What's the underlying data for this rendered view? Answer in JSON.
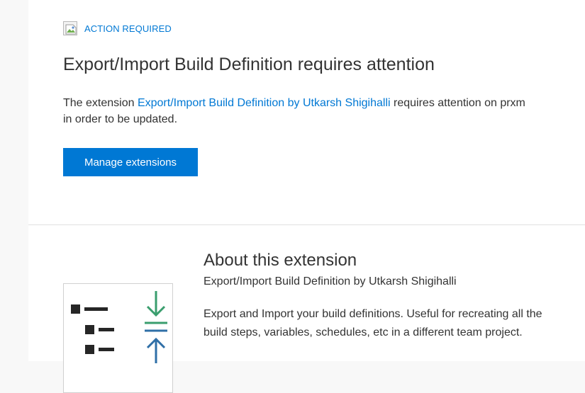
{
  "notice": {
    "badge_label": "ACTION REQUIRED",
    "badge_icon": "broken-image-icon",
    "title": "Export/Import Build Definition requires attention",
    "body_prefix": "The extension ",
    "extension_link": "Export/Import Build Definition by Utkarsh Shigihalli",
    "body_suffix": " requires attention on prxm in order to be updated.",
    "manage_button_label": "Manage extensions"
  },
  "about": {
    "heading": "About this extension",
    "subtitle": "Export/Import Build Definition by Utkarsh Shigihalli",
    "description": "Export and Import your build definitions. Useful for recreating all the build steps, variables, schedules, etc in a different team project.",
    "logo_icon": "export-import-logo-icon"
  },
  "colors": {
    "accent": "#0078d4",
    "text": "#333333",
    "logo_green": "#3a9e6e",
    "logo_blue": "#2f6fa7",
    "logo_dark": "#262626"
  }
}
